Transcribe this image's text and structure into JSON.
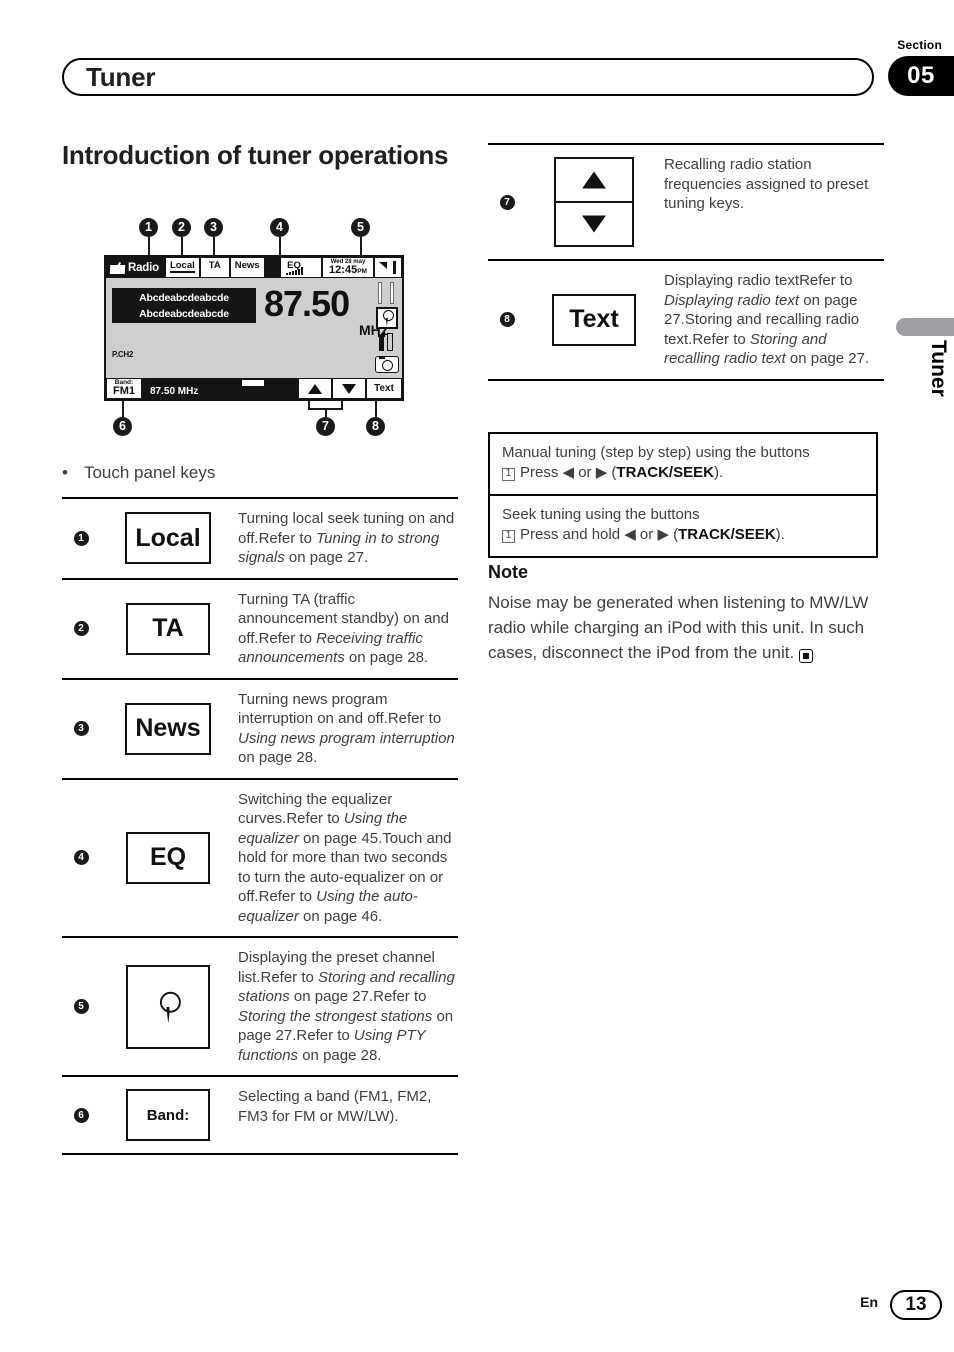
{
  "header": {
    "section_word": "Section",
    "section_number": "05",
    "chapter_title": "Tuner"
  },
  "edge_tab": {
    "label": "Tuner"
  },
  "page_heading": "Introduction of tuner operations",
  "device": {
    "source_label": "Radio",
    "source_icon": "radio-icon",
    "top_buttons": [
      "Local",
      "TA",
      "News"
    ],
    "eq_label": "EQ",
    "clock_date": "Wed 28 may",
    "clock_time": "12:45",
    "clock_ampm": "PM",
    "radio_text_line1": "Abcdeabcdeabcde",
    "radio_text_line2": "Abcdeabcdeabcde",
    "preset_channel": "P.CH2",
    "frequency": "87.50",
    "frequency_unit": "MHz",
    "band_caption": "Band:",
    "band_value": "FM1",
    "bar_frequency": "87.50 MHz",
    "text_button": "Text",
    "callouts": [
      "1",
      "2",
      "3",
      "4",
      "5",
      "6",
      "7",
      "8"
    ]
  },
  "bullet": {
    "text": "Touch panel keys"
  },
  "left_table": [
    {
      "num": "1",
      "key_label": "Local",
      "key_style": "text",
      "desc": [
        {
          "t": "Turning local seek tuning on and off."
        },
        {
          "t": "Refer to "
        },
        {
          "i": "Tuning in to strong signals"
        },
        {
          "t": " on page 27."
        }
      ]
    },
    {
      "num": "2",
      "key_label": "TA",
      "key_style": "text",
      "desc": [
        {
          "t": "Turning TA (traffic announcement standby) on and off."
        },
        {
          "t": "Refer to "
        },
        {
          "i": "Receiving traffic announcements"
        },
        {
          "t": " on page 28."
        }
      ]
    },
    {
      "num": "3",
      "key_label": "News",
      "key_style": "text",
      "desc": [
        {
          "t": "Turning news program interruption on and off."
        },
        {
          "t": "Refer to "
        },
        {
          "i": "Using news program interruption"
        },
        {
          "t": " on page 28."
        }
      ]
    },
    {
      "num": "4",
      "key_label": "EQ",
      "key_style": "text",
      "desc": [
        {
          "t": "Switching the equalizer curves."
        },
        {
          "t": "Refer to "
        },
        {
          "i": "Using the equalizer"
        },
        {
          "t": " on page 45."
        },
        {
          "t": "Touch and hold for more than two seconds to turn the auto-equalizer on or off."
        },
        {
          "t": "Refer to "
        },
        {
          "i": "Using the auto-equalizer"
        },
        {
          "t": " on page 46."
        }
      ]
    },
    {
      "num": "5",
      "key_label": "pin-icon",
      "key_style": "icon",
      "desc": [
        {
          "t": "Displaying the preset channel list."
        },
        {
          "t": "Refer to "
        },
        {
          "i": "Storing and recalling stations"
        },
        {
          "t": " on page 27."
        },
        {
          "t": "Refer to "
        },
        {
          "i": "Storing the strongest stations"
        },
        {
          "t": " on page 27."
        },
        {
          "t": "Refer to "
        },
        {
          "i": "Using PTY functions"
        },
        {
          "t": " on page 28."
        }
      ]
    },
    {
      "num": "6",
      "key_label": "Band:",
      "key_style": "small",
      "desc": [
        {
          "t": "Selecting a band (FM1, FM2, FM3 for FM or MW/LW)."
        }
      ]
    }
  ],
  "right_table": [
    {
      "num": "7",
      "key_label": "up-down-arrows",
      "key_style": "arrows",
      "desc": [
        {
          "t": "Recalling radio station frequencies assigned to preset tuning keys."
        }
      ]
    },
    {
      "num": "8",
      "key_label": "Text",
      "key_style": "text",
      "desc": [
        {
          "t": "Displaying radio text"
        },
        {
          "t": "Refer to "
        },
        {
          "i": "Displaying radio text"
        },
        {
          "t": " on page 27."
        },
        {
          "t": "Storing and recalling radio text."
        },
        {
          "t": "Refer to "
        },
        {
          "i": "Storing and recalling radio text"
        },
        {
          "t": " on page 27."
        }
      ]
    }
  ],
  "procedures": [
    {
      "title": "Manual tuning (step by step) using the buttons",
      "step_num": "1",
      "step_pre": "Press ◀ or ▶ (",
      "step_bold": "TRACK/SEEK",
      "step_post": ")."
    },
    {
      "title": "Seek tuning using the buttons",
      "step_num": "1",
      "step_pre": "Press and hold ◀ or ▶ (",
      "step_bold": "TRACK/SEEK",
      "step_post": ")."
    }
  ],
  "note": {
    "heading": "Note",
    "body": "Noise may be generated when listening to MW/LW radio while charging an iPod with this unit. In such cases, disconnect the iPod from the unit."
  },
  "footer": {
    "language": "En",
    "page_number": "13"
  }
}
